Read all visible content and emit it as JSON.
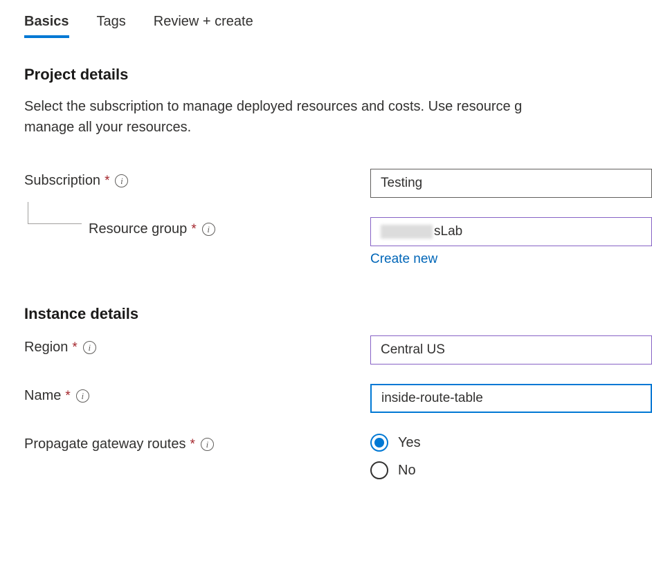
{
  "tabs": {
    "basics": "Basics",
    "tags": "Tags",
    "review": "Review + create"
  },
  "project_details": {
    "title": "Project details",
    "description_line1": "Select the subscription to manage deployed resources and costs. Use resource g",
    "description_line2": "manage all your resources.",
    "subscription": {
      "label": "Subscription",
      "value": "Testing"
    },
    "resource_group": {
      "label": "Resource group",
      "value": "sLab",
      "create_new": "Create new"
    }
  },
  "instance_details": {
    "title": "Instance details",
    "region": {
      "label": "Region",
      "value": "Central US"
    },
    "name": {
      "label": "Name",
      "value": "inside-route-table"
    },
    "propagate": {
      "label": "Propagate gateway routes",
      "options": {
        "yes": "Yes",
        "no": "No"
      },
      "selected": "yes"
    }
  }
}
